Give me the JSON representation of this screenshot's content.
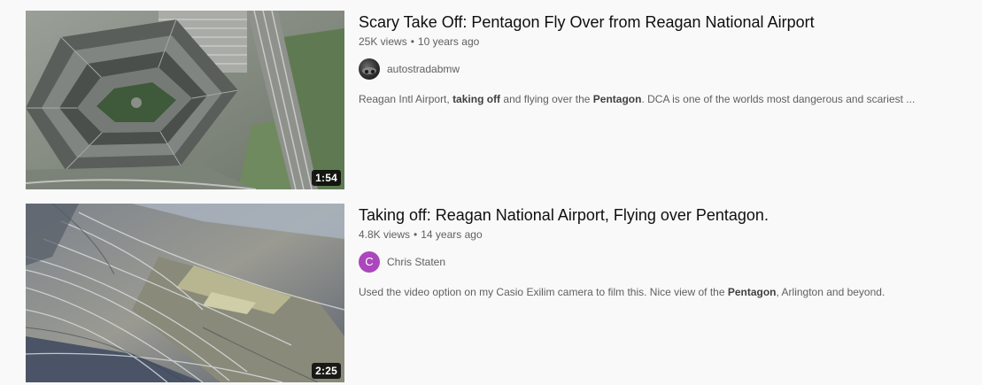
{
  "videos": [
    {
      "title": "Scary Take Off: Pentagon Fly Over from Reagan National Airport",
      "views": "25K views",
      "age": "10 years ago",
      "duration": "1:54",
      "channel": {
        "name": "autostradabmw",
        "avatar": "channel-photo-avatar"
      },
      "description": {
        "p1": "Reagan Intl Airport, ",
        "b1": "taking off",
        "p2": " and flying over the ",
        "b2": "Pentagon",
        "p3": ". DCA is one of the worlds most dangerous and scariest ..."
      }
    },
    {
      "title": "Taking off: Reagan National Airport, Flying over Pentagon.",
      "views": "4.8K views",
      "age": "14 years ago",
      "duration": "2:25",
      "channel": {
        "name": "Chris Staten",
        "avatar_letter": "C",
        "avatar_color": "#ab47bc"
      },
      "description": {
        "p1": "Used the video option on my Casio Exilim camera to film this. Nice view of the ",
        "b1": "Pentagon",
        "p2": ", Arlington and beyond."
      }
    }
  ],
  "meta_separator": "•"
}
